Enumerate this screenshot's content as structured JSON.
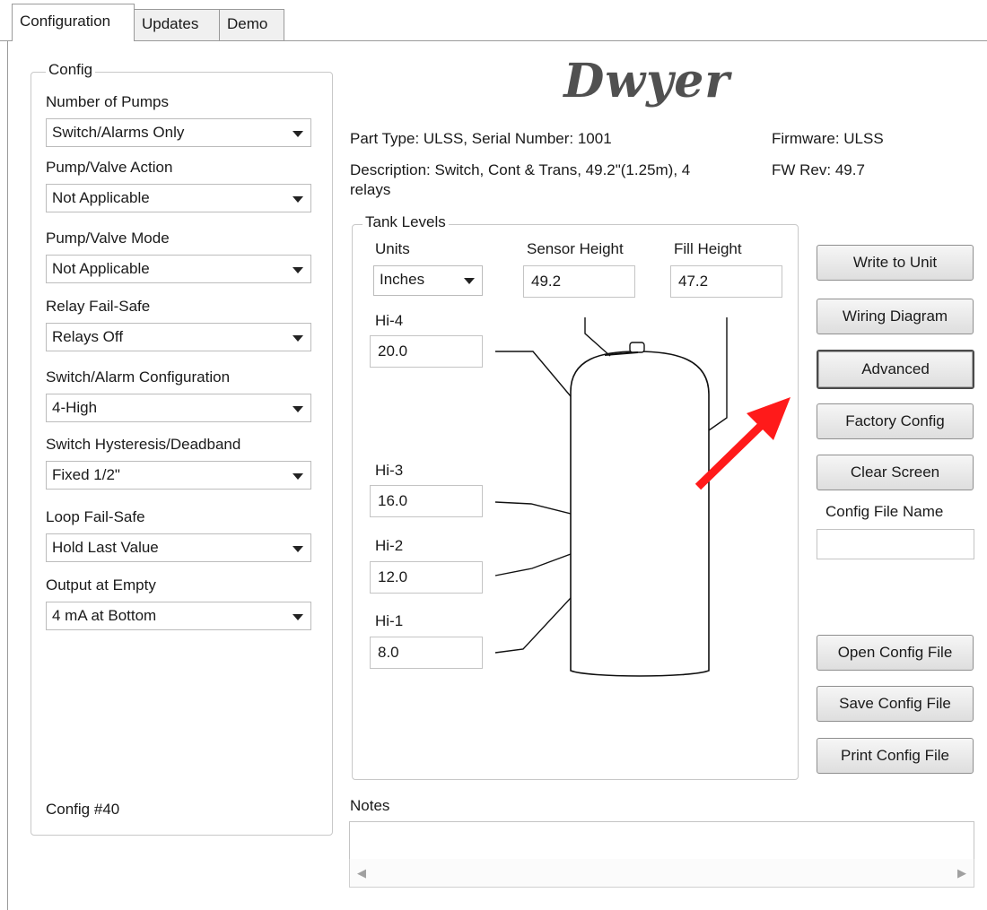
{
  "tabs": [
    "Configuration",
    "Updates",
    "Demo"
  ],
  "config": {
    "group_label": "Config",
    "fields": [
      {
        "label": "Number of Pumps",
        "value": "Switch/Alarms Only"
      },
      {
        "label": "Pump/Valve Action",
        "value": "Not Applicable"
      },
      {
        "label": "Pump/Valve Mode",
        "value": "Not Applicable"
      },
      {
        "label": "Relay Fail-Safe",
        "value": "Relays Off"
      },
      {
        "label": "Switch/Alarm Configuration",
        "value": "4-High"
      },
      {
        "label": "Switch Hysteresis/Deadband",
        "value": "Fixed 1/2\""
      },
      {
        "label": "Loop Fail-Safe",
        "value": "Hold Last Value"
      },
      {
        "label": "Output at Empty",
        "value": "4 mA at Bottom"
      }
    ],
    "config_number": "Config #40"
  },
  "logo": "Dwyer",
  "info": {
    "part_line": "Part Type: ULSS, Serial Number: 1001",
    "description_line1": "Description: Switch, Cont & Trans, 49.2\"(1.25m), 4",
    "description_line2": "relays",
    "firmware": "Firmware: ULSS",
    "fw_rev": "FW Rev:  49.7"
  },
  "tank": {
    "group_label": "Tank Levels",
    "units_label": "Units",
    "units_value": "Inches",
    "sensor_height_label": "Sensor Height",
    "sensor_height_value": "49.2",
    "fill_height_label": "Fill Height",
    "fill_height_value": "47.2",
    "levels": [
      {
        "label": "Hi-4",
        "value": "20.0"
      },
      {
        "label": "Hi-3",
        "value": "16.0"
      },
      {
        "label": "Hi-2",
        "value": "12.0"
      },
      {
        "label": "Hi-1",
        "value": "8.0"
      }
    ]
  },
  "buttons": {
    "write": "Write to Unit",
    "wiring": "Wiring Diagram",
    "advanced": "Advanced",
    "factory": "Factory Config",
    "clear": "Clear Screen",
    "config_file_name_label": "Config File Name",
    "config_file_name_value": "",
    "open": "Open Config File",
    "save": "Save Config File",
    "print": "Print Config File"
  },
  "notes": {
    "label": "Notes",
    "value": ""
  },
  "colors": {
    "annotation_arrow": "#ff0000"
  }
}
